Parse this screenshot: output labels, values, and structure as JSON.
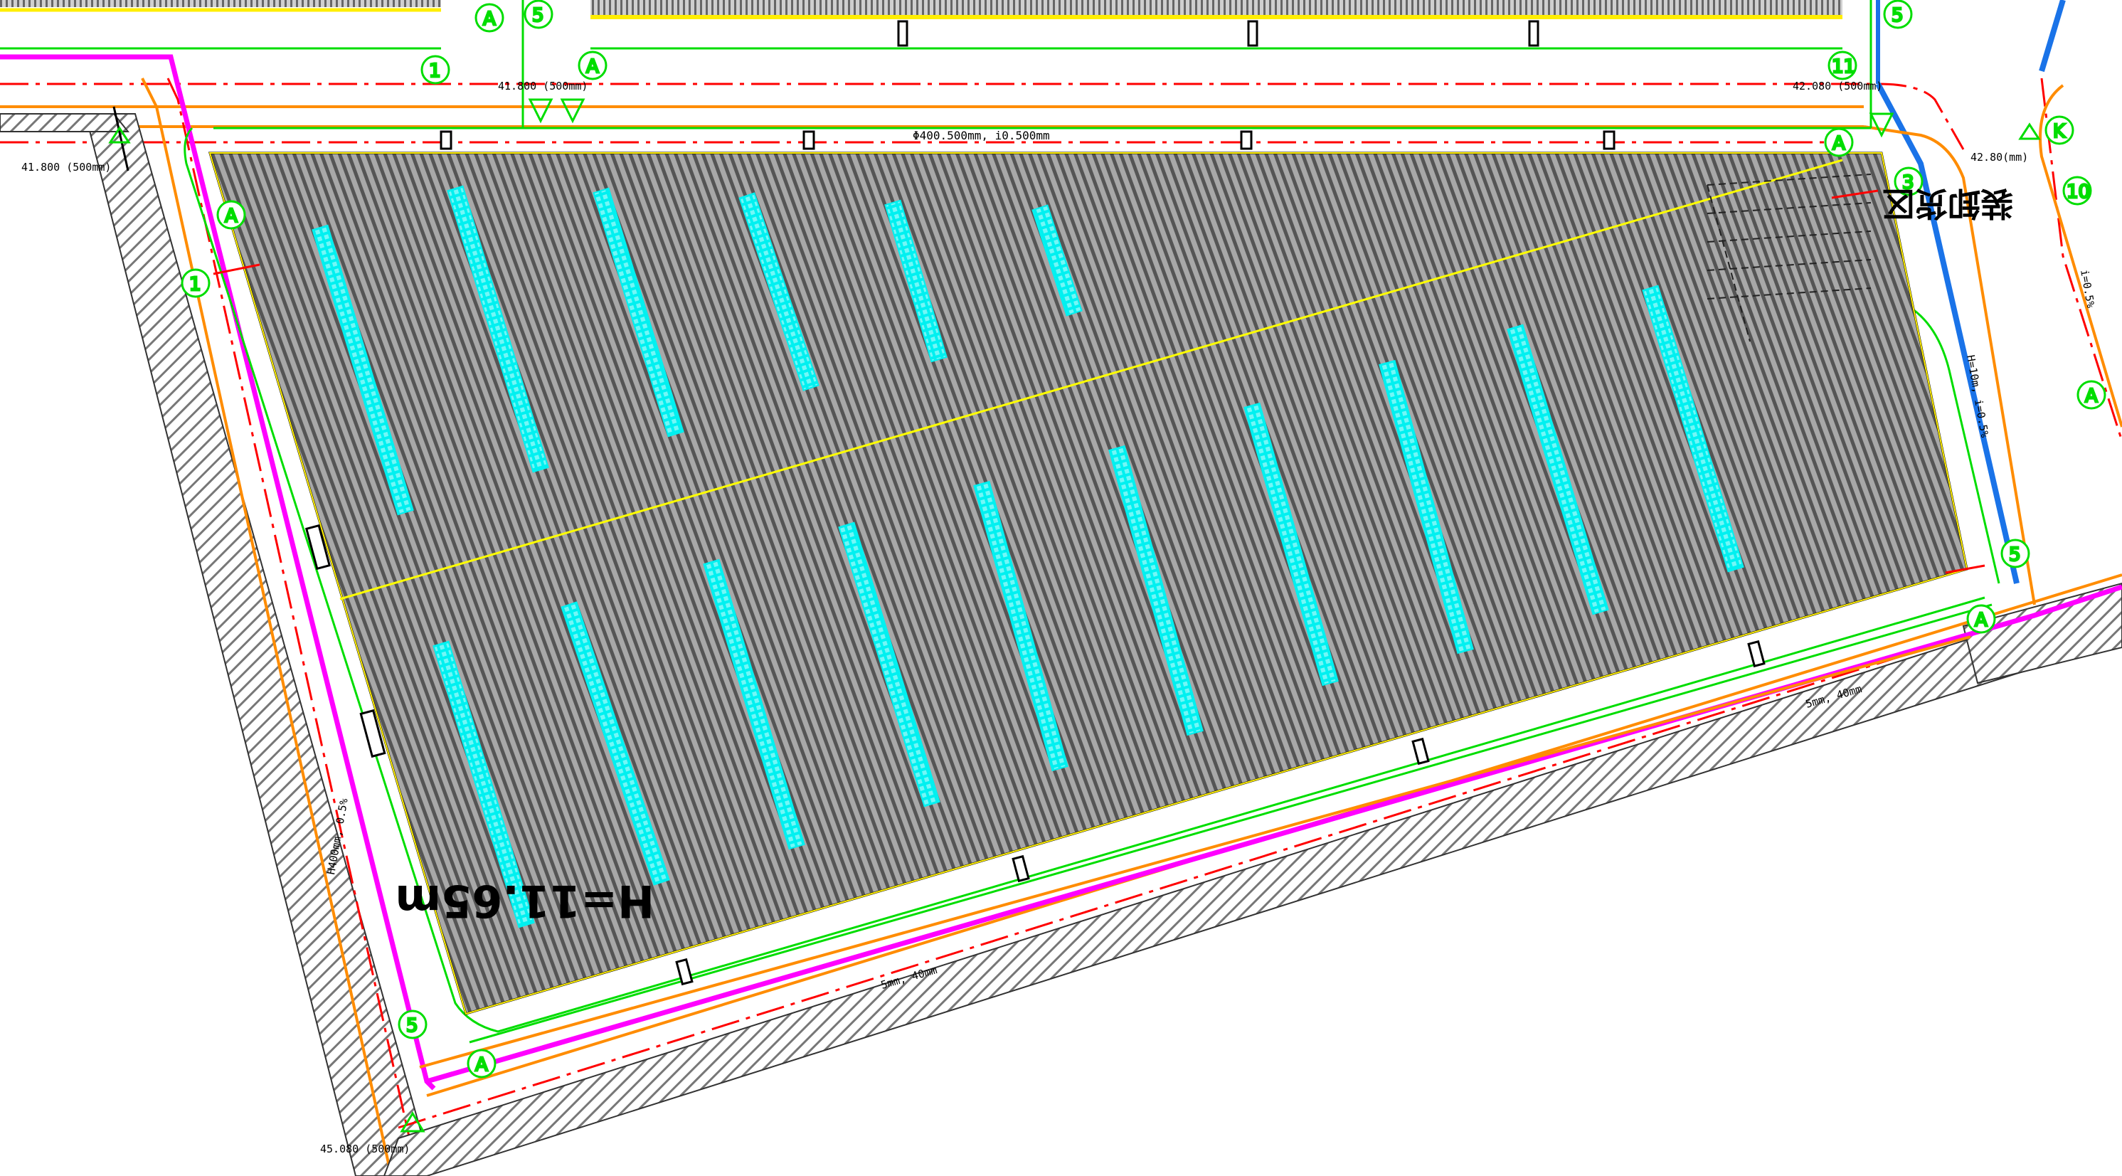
{
  "drawing": {
    "roof_height_label": "H=11.65m",
    "zone_label": "装卸货区",
    "dimension_labels": {
      "top_center": "Φ400.500mm, i0.500mm",
      "top_left_elev": "41.800 (500mm)",
      "top_mid_elev": "41.800 (500mm)",
      "top_right_elev": "42.080 (500mm)",
      "right_top_elev": "42.80(mm)",
      "left_vertical": "H400mm, 0.5%",
      "bottom_left_elev": "45.080 (500mm)",
      "bottom_mid": "5mm, 40mm",
      "bottom_right": "5mm, 40mm",
      "right_vertical": "H=10m, i=0.5%",
      "far_right_vertical": "i=0.5%"
    },
    "markers": [
      {
        "id": "marker-1-top",
        "text": "1"
      },
      {
        "id": "marker-A-top",
        "text": "A"
      },
      {
        "id": "marker-5-top",
        "text": "5"
      },
      {
        "id": "marker-A-mid",
        "text": "A"
      },
      {
        "id": "marker-5-right",
        "text": "5"
      },
      {
        "id": "marker-11",
        "text": "11"
      },
      {
        "id": "marker-K",
        "text": "K"
      },
      {
        "id": "marker-10",
        "text": "10"
      },
      {
        "id": "marker-A-corner",
        "text": "A"
      },
      {
        "id": "marker-3",
        "text": "3"
      },
      {
        "id": "marker-A-left",
        "text": "A"
      },
      {
        "id": "marker-1-left",
        "text": "1"
      },
      {
        "id": "marker-A-right",
        "text": "A"
      },
      {
        "id": "marker-5-east",
        "text": "5"
      },
      {
        "id": "marker-A-east",
        "text": "A"
      },
      {
        "id": "marker-5-sw",
        "text": "5"
      },
      {
        "id": "marker-A-sw",
        "text": "A"
      }
    ],
    "colors": {
      "roof_fill": "#9a9a9a",
      "roof_stripe": "#5a5a5a",
      "skylight": "#00f0f0",
      "ridge": "#ffff00",
      "fence": "#ff00ff",
      "road_edge": "#ff8c00",
      "pipe": "#00dd00",
      "boundary": "#ff0000",
      "blue_line": "#1a73e8"
    },
    "skylight_count": 16
  }
}
